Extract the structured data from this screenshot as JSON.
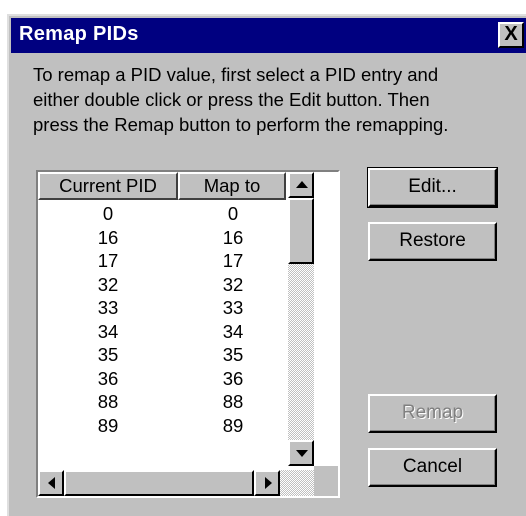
{
  "window": {
    "title": "Remap PIDs",
    "close_glyph": "X"
  },
  "description": "To remap a PID value, first select a PID entry and\neither double click or press the Edit button. Then\npress the Remap button to perform the remapping.",
  "table": {
    "columns": [
      "Current PID",
      "Map to"
    ],
    "rows": [
      [
        "0",
        "0"
      ],
      [
        "16",
        "16"
      ],
      [
        "17",
        "17"
      ],
      [
        "32",
        "32"
      ],
      [
        "33",
        "33"
      ],
      [
        "34",
        "34"
      ],
      [
        "35",
        "35"
      ],
      [
        "36",
        "36"
      ],
      [
        "88",
        "88"
      ],
      [
        "89",
        "89"
      ]
    ]
  },
  "buttons": {
    "edit": "Edit...",
    "restore": "Restore",
    "remap": "Remap",
    "cancel": "Cancel"
  },
  "icons": {
    "scroll_up": "arrow-up-icon",
    "scroll_down": "arrow-down-icon",
    "scroll_left": "arrow-left-icon",
    "scroll_right": "arrow-right-icon"
  },
  "colors": {
    "titlebar": "#000080",
    "face": "#c0c0c0",
    "disabled_text": "#808080"
  }
}
